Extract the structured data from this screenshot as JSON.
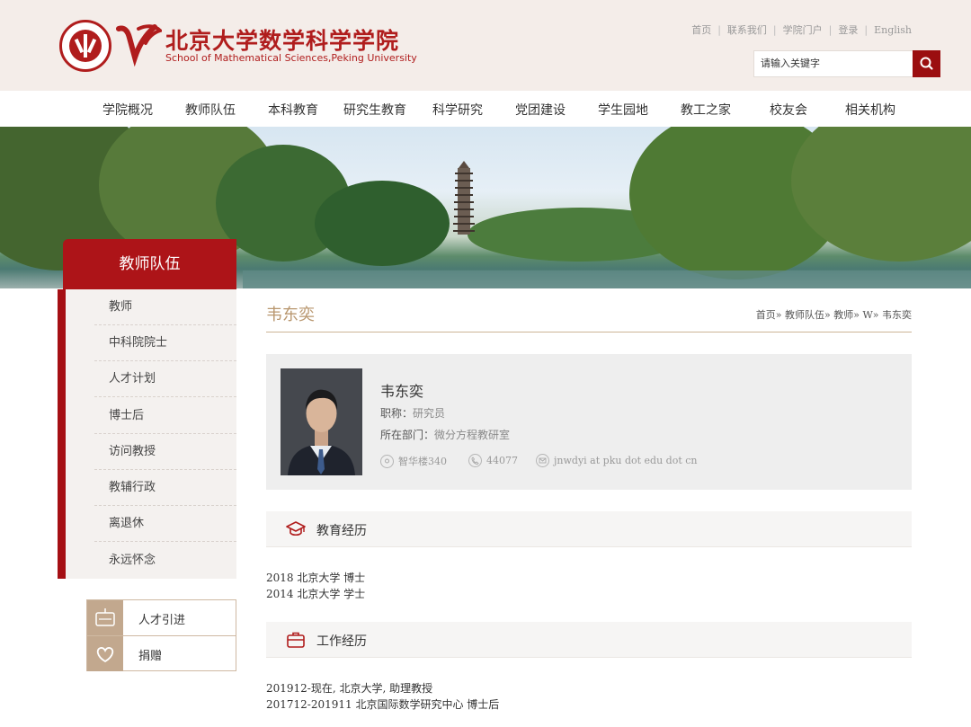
{
  "header": {
    "title_cn": "北京大学数学科学学院",
    "title_en": "School of Mathematical Sciences,Peking University",
    "top_links": [
      "首页",
      "联系我们",
      "学院门户",
      "登录",
      "English"
    ],
    "search_placeholder": "请输入关键字",
    "brand_color": "#b01d1d"
  },
  "nav": [
    "学院概况",
    "教师队伍",
    "本科教育",
    "研究生教育",
    "科学研究",
    "党团建设",
    "学生园地",
    "教工之家",
    "校友会",
    "相关机构"
  ],
  "sidebar": {
    "title": "教师队伍",
    "items": [
      "教师",
      "中科院院士",
      "人才计划",
      "博士后",
      "访问教授",
      "教辅行政",
      "离退休",
      "永远怀念"
    ],
    "quick": [
      "人才引进",
      "捐赠"
    ]
  },
  "page": {
    "title": "韦东奕",
    "breadcrumb": "首页» 教师队伍» 教师» W» 韦东奕"
  },
  "profile": {
    "name": "韦东奕",
    "title_label": "职称：",
    "title_value": "研究员",
    "dept_label": "所在部门：",
    "dept_value": "微分方程教研室",
    "office": "智华楼340",
    "phone": "44077",
    "email": "jnwdyi at pku dot edu dot cn"
  },
  "education": {
    "heading": "教育经历",
    "lines": [
      "2018 北京大学 博士",
      "2014 北京大学 学士"
    ]
  },
  "work": {
    "heading": "工作经历",
    "lines": [
      "201912-现在, 北京大学, 助理教授",
      "201712-201911 北京国际数学研究中心 博士后"
    ]
  }
}
